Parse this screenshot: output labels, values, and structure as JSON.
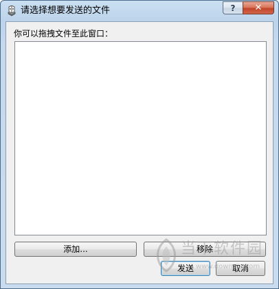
{
  "window": {
    "title": "请选择想要发送的文件",
    "help_label": "?",
    "close_label": "✕",
    "app_icon": "file-transfer-icon"
  },
  "main": {
    "drop_label": "你可以拖拽文件至此窗口：",
    "file_list": []
  },
  "buttons": {
    "add_label": "添加...",
    "remove_label": "移除",
    "send_label": "发送",
    "cancel_label": "取消"
  },
  "watermark": {
    "name": "当下软件园",
    "url": "www.downxia.com",
    "icon": "downxia-logo-icon"
  },
  "colors": {
    "titlebar": "#c4d8ee",
    "close_button": "#c2452a",
    "client_background": "#f0f0f0",
    "list_background": "#ffffff",
    "default_button_border": "#3c7fb1"
  }
}
